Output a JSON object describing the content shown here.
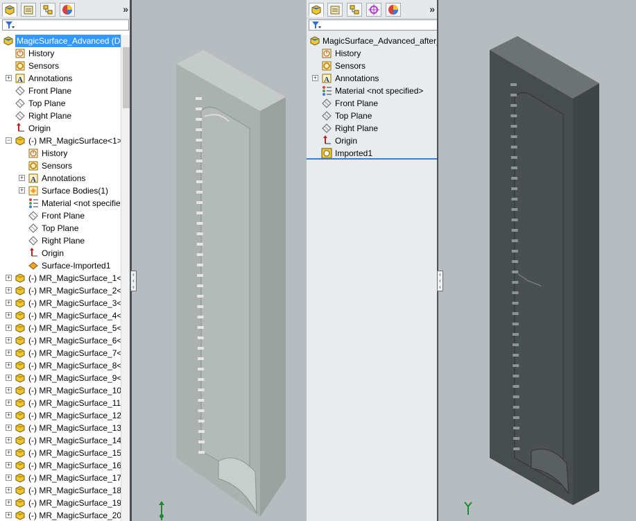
{
  "left_panel": {
    "root": "MagicSurface_Advanced  (De",
    "items": [
      {
        "label": "History",
        "icon": "history-icon",
        "depth": 1
      },
      {
        "label": "Sensors",
        "icon": "sensor-icon",
        "depth": 1
      },
      {
        "label": "Annotations",
        "icon": "annotation-icon",
        "depth": 1,
        "expand": true
      },
      {
        "label": "Front Plane",
        "icon": "plane-icon",
        "depth": 1
      },
      {
        "label": "Top Plane",
        "icon": "plane-icon",
        "depth": 1
      },
      {
        "label": "Right Plane",
        "icon": "plane-icon",
        "depth": 1
      },
      {
        "label": "Origin",
        "icon": "origin-icon",
        "depth": 1
      },
      {
        "label": "(-) MR_MagicSurface<1>",
        "icon": "part-icon",
        "depth": 1,
        "expand": true,
        "open": true
      },
      {
        "label": "History",
        "icon": "history-icon",
        "depth": 2
      },
      {
        "label": "Sensors",
        "icon": "sensor-icon",
        "depth": 2
      },
      {
        "label": "Annotations",
        "icon": "annotation-icon",
        "depth": 2,
        "expand": true
      },
      {
        "label": "Surface Bodies(1)",
        "icon": "surface-bodies-icon",
        "depth": 2,
        "expand": true
      },
      {
        "label": "Material <not specified>",
        "icon": "material-icon",
        "depth": 2
      },
      {
        "label": "Front Plane",
        "icon": "plane-icon",
        "depth": 2
      },
      {
        "label": "Top Plane",
        "icon": "plane-icon",
        "depth": 2
      },
      {
        "label": "Right Plane",
        "icon": "plane-icon",
        "depth": 2
      },
      {
        "label": "Origin",
        "icon": "origin-icon",
        "depth": 2
      },
      {
        "label": "Surface-Imported1",
        "icon": "surface-icon",
        "depth": 2
      },
      {
        "label": "(-) MR_MagicSurface_1<",
        "icon": "part-icon",
        "depth": 1,
        "expand": true
      },
      {
        "label": "(-) MR_MagicSurface_2<",
        "icon": "part-icon",
        "depth": 1,
        "expand": true
      },
      {
        "label": "(-) MR_MagicSurface_3<",
        "icon": "part-icon",
        "depth": 1,
        "expand": true
      },
      {
        "label": "(-) MR_MagicSurface_4<",
        "icon": "part-icon",
        "depth": 1,
        "expand": true
      },
      {
        "label": "(-) MR_MagicSurface_5<",
        "icon": "part-icon",
        "depth": 1,
        "expand": true
      },
      {
        "label": "(-) MR_MagicSurface_6<",
        "icon": "part-icon",
        "depth": 1,
        "expand": true
      },
      {
        "label": "(-) MR_MagicSurface_7<",
        "icon": "part-icon",
        "depth": 1,
        "expand": true
      },
      {
        "label": "(-) MR_MagicSurface_8<",
        "icon": "part-icon",
        "depth": 1,
        "expand": true
      },
      {
        "label": "(-) MR_MagicSurface_9<",
        "icon": "part-icon",
        "depth": 1,
        "expand": true
      },
      {
        "label": "(-) MR_MagicSurface_10<",
        "icon": "part-icon",
        "depth": 1,
        "expand": true
      },
      {
        "label": "(-) MR_MagicSurface_11<",
        "icon": "part-icon",
        "depth": 1,
        "expand": true
      },
      {
        "label": "(-) MR_MagicSurface_12<",
        "icon": "part-icon",
        "depth": 1,
        "expand": true
      },
      {
        "label": "(-) MR_MagicSurface_13<",
        "icon": "part-icon",
        "depth": 1,
        "expand": true
      },
      {
        "label": "(-) MR_MagicSurface_14<",
        "icon": "part-icon",
        "depth": 1,
        "expand": true
      },
      {
        "label": "(-) MR_MagicSurface_15<",
        "icon": "part-icon",
        "depth": 1,
        "expand": true
      },
      {
        "label": "(-) MR_MagicSurface_16<",
        "icon": "part-icon",
        "depth": 1,
        "expand": true
      },
      {
        "label": "(-) MR_MagicSurface_17<",
        "icon": "part-icon",
        "depth": 1,
        "expand": true
      },
      {
        "label": "(-) MR_MagicSurface_18<",
        "icon": "part-icon",
        "depth": 1,
        "expand": true
      },
      {
        "label": "(-) MR_MagicSurface_19<",
        "icon": "part-icon",
        "depth": 1,
        "expand": true
      },
      {
        "label": "(-) MR_MagicSurface_20<",
        "icon": "part-icon",
        "depth": 1,
        "expand": true
      }
    ]
  },
  "right_panel": {
    "root": "MagicSurface_Advanced_after_",
    "items": [
      {
        "label": "History",
        "icon": "history-icon",
        "depth": 1
      },
      {
        "label": "Sensors",
        "icon": "sensor-icon",
        "depth": 1
      },
      {
        "label": "Annotations",
        "icon": "annotation-icon",
        "depth": 1,
        "expand": true
      },
      {
        "label": "Material <not specified>",
        "icon": "material-icon",
        "depth": 1
      },
      {
        "label": "Front Plane",
        "icon": "plane-icon",
        "depth": 1
      },
      {
        "label": "Top Plane",
        "icon": "plane-icon",
        "depth": 1
      },
      {
        "label": "Right Plane",
        "icon": "plane-icon",
        "depth": 1
      },
      {
        "label": "Origin",
        "icon": "origin-icon",
        "depth": 1
      },
      {
        "label": "Imported1",
        "icon": "imported-body-icon",
        "depth": 1
      }
    ]
  },
  "tabs_left": [
    "feature-manager-tab",
    "property-manager-tab",
    "configuration-manager-tab",
    "display-manager-tab"
  ],
  "tabs_right": [
    "feature-manager-tab",
    "property-manager-tab",
    "configuration-manager-tab",
    "dimxpert-tab",
    "display-manager-tab"
  ],
  "expand_glyph": "»",
  "colors": {
    "selection": "#3399ff",
    "left_model": "#a9b0ad",
    "right_model": "#454a4b"
  }
}
